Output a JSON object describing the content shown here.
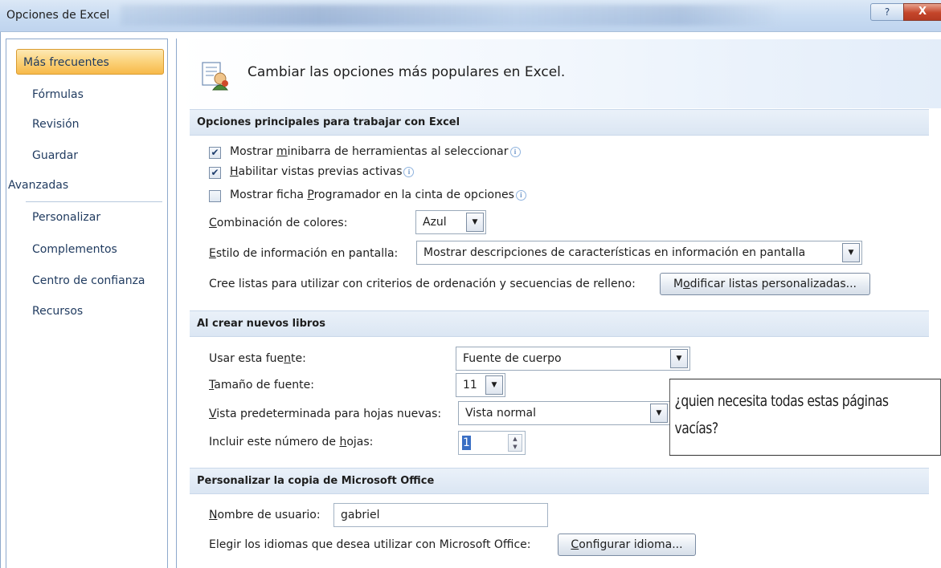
{
  "window": {
    "title": "Opciones de Excel",
    "help_label": "?",
    "close_label": "X"
  },
  "sidebar": {
    "items": [
      {
        "label": "Más frecuentes",
        "selected": true
      },
      {
        "label": "Fórmulas"
      },
      {
        "label": "Revisión"
      },
      {
        "label": "Guardar"
      },
      {
        "label": "Avanzadas"
      },
      {
        "label": "Personalizar"
      },
      {
        "label": "Complementos"
      },
      {
        "label": "Centro de confianza"
      },
      {
        "label": "Recursos"
      }
    ]
  },
  "header": {
    "title": "Cambiar las opciones más populares en Excel."
  },
  "section1": {
    "title": "Opciones principales para trabajar con Excel",
    "check1": {
      "pre": "Mostrar ",
      "key": "m",
      "post": "inibarra de herramientas al seleccionar",
      "checked": true
    },
    "check2": {
      "pre": "",
      "key": "H",
      "post": "abilitar vistas previas activas",
      "checked": true
    },
    "check3": {
      "pre": "Mostrar ficha ",
      "key": "P",
      "post": "rogramador en la cinta de opciones",
      "checked": false
    },
    "color_label": {
      "pre": "",
      "key": "C",
      "post": "ombinación de colores:"
    },
    "color_value": "Azul",
    "style_label": {
      "pre": "",
      "key": "E",
      "post": "stilo de información en pantalla:"
    },
    "style_value": "Mostrar descripciones de características en información en pantalla",
    "lists_label": "Cree listas para utilizar con criterios de ordenación y secuencias de relleno:",
    "lists_button": {
      "pre": "M",
      "key": "o",
      "post": "dificar listas personalizadas..."
    }
  },
  "section2": {
    "title": "Al crear nuevos libros",
    "font_label": {
      "pre": "Usar esta fue",
      "key": "n",
      "post": "te:"
    },
    "font_value": "Fuente de cuerpo",
    "size_label": {
      "pre": "",
      "key": "T",
      "post": "amaño de fuente:"
    },
    "size_value": "11",
    "view_label": {
      "pre": "",
      "key": "V",
      "post": "ista predeterminada para hojas nuevas:"
    },
    "view_value": "Vista normal",
    "sheets_label": {
      "pre": "Incluir este número de ",
      "key": "h",
      "post": "ojas:"
    },
    "sheets_value": "1"
  },
  "section3": {
    "title": "Personalizar la copia de Microsoft Office",
    "user_label": {
      "pre": "",
      "key": "N",
      "post": "ombre de usuario:"
    },
    "user_value": "gabriel",
    "lang_label": "Elegir los idiomas que desea utilizar con Microsoft Office:",
    "lang_button": {
      "pre": "",
      "key": "C",
      "post": "onfigurar idioma..."
    }
  },
  "annotation": {
    "line1": "¿quien necesita todas estas páginas",
    "line2": "vacías?"
  }
}
